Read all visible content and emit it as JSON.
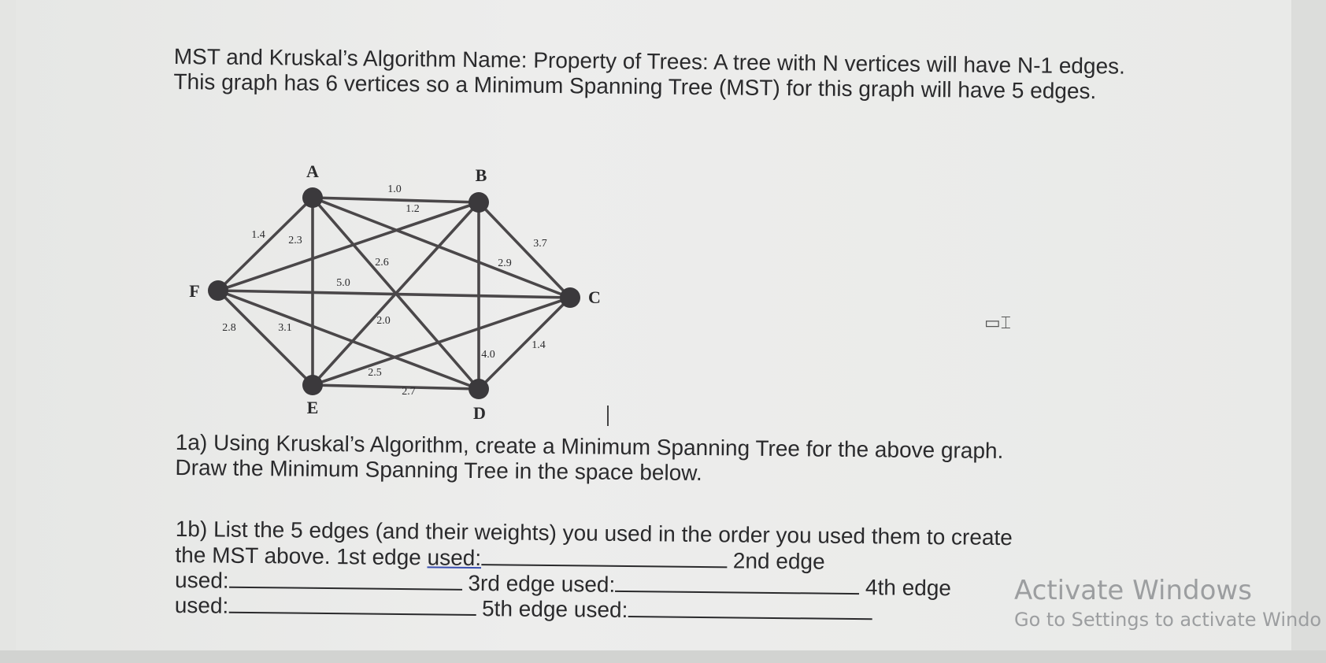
{
  "intro": "MST and Kruskal’s Algorithm Name: Property of Trees: A tree with N vertices will have N-1 edges. This graph has 6 vertices so a Minimum Spanning Tree (MST) for this graph will have 5 edges.",
  "graph": {
    "vertices": [
      "A",
      "B",
      "C",
      "D",
      "E",
      "F"
    ],
    "edges": [
      {
        "from": "A",
        "to": "B",
        "weight": "1.0"
      },
      {
        "from": "F",
        "to": "B",
        "weight": "1.2"
      },
      {
        "from": "F",
        "to": "A",
        "weight": "1.4"
      },
      {
        "from": "A",
        "to": "E",
        "weight": "2.3"
      },
      {
        "from": "A",
        "to": "D",
        "weight": "2.6"
      },
      {
        "from": "B",
        "to": "C",
        "weight": "3.7"
      },
      {
        "from": "A",
        "to": "C",
        "weight": "2.9"
      },
      {
        "from": "F",
        "to": "C",
        "weight": "5.0"
      },
      {
        "from": "F",
        "to": "E",
        "weight": "2.8"
      },
      {
        "from": "F",
        "to": "D",
        "weight": "3.1"
      },
      {
        "from": "B",
        "to": "E",
        "weight": "2.0"
      },
      {
        "from": "B",
        "to": "D",
        "weight": "4.0"
      },
      {
        "from": "C",
        "to": "D",
        "weight": "1.4"
      },
      {
        "from": "E",
        "to": "C",
        "weight": "2.5"
      },
      {
        "from": "E",
        "to": "D",
        "weight": "2.7"
      }
    ]
  },
  "q1a": {
    "line1": "1a) Using Kruskal’s Algorithm, create a Minimum Spanning Tree for the above graph.",
    "line2": "Draw the Minimum Spanning Tree in the space below."
  },
  "q1b": {
    "line1": "1b) List the 5 edges (and their weights) you used in the order you used them to create",
    "line2_a": "the MST above. 1st edge ",
    "line2_used": "used:",
    "line2_b": "2nd edge",
    "line3_a": "used:",
    "line3_b": "3rd edge used:",
    "line3_c": "4th edge",
    "line4_a": "used:",
    "line4_b": "5th edge used:"
  },
  "watermark": {
    "title": "Activate Windows",
    "subtitle": "Go to Settings to activate Windo"
  }
}
